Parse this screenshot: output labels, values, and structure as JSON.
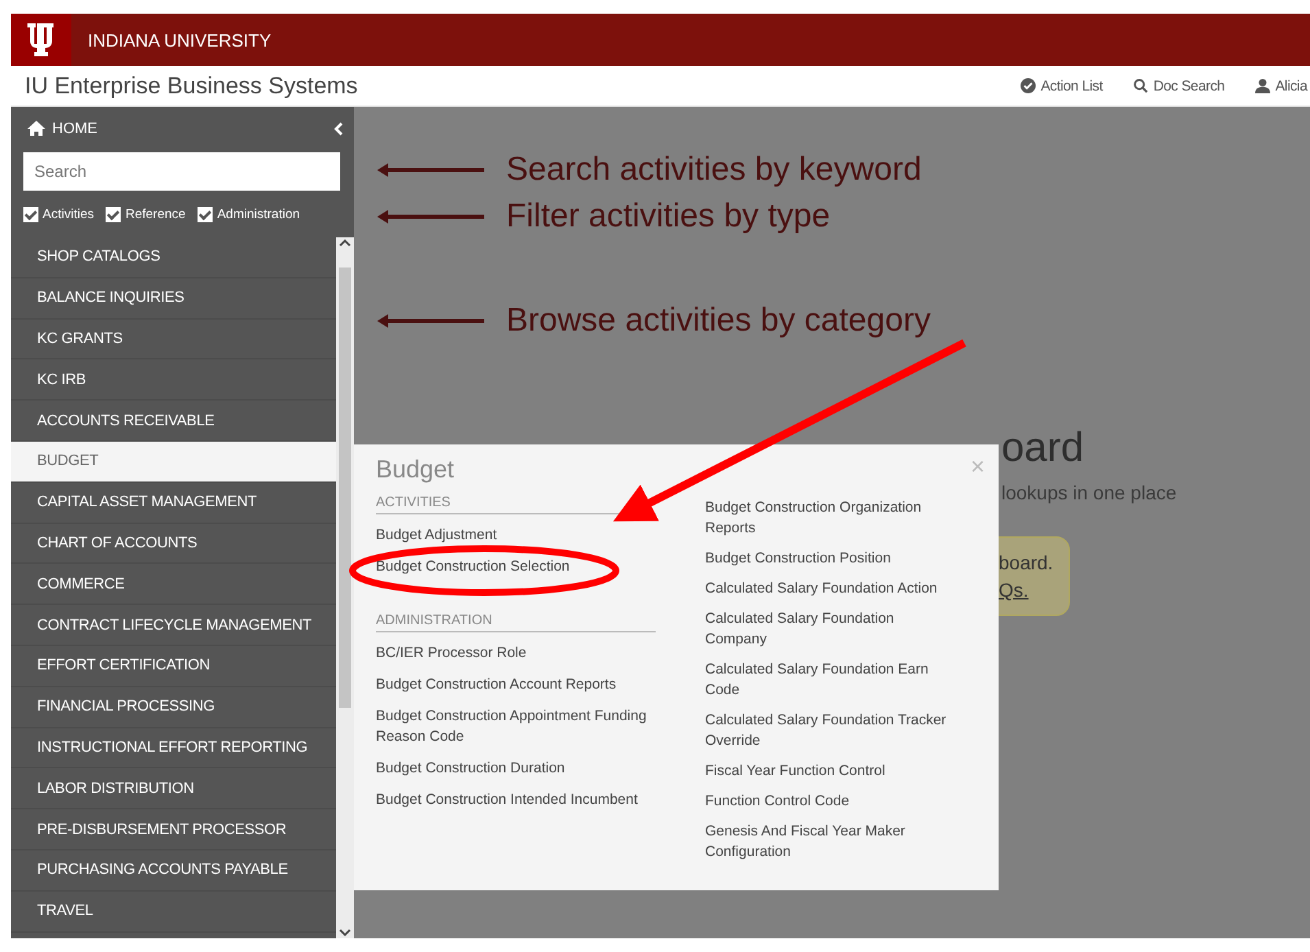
{
  "header": {
    "brand": "INDIANA UNIVERSITY"
  },
  "title_bar": {
    "title": "IU Enterprise Business Systems",
    "links": [
      {
        "kind": "check",
        "label": "Action List"
      },
      {
        "kind": "search",
        "label": "Doc Search"
      },
      {
        "kind": "user",
        "label": "Alicia"
      }
    ]
  },
  "sidebar": {
    "home": "HOME",
    "search": {
      "placeholder": "Search"
    },
    "filters": [
      {
        "label": "Activities",
        "checked": true
      },
      {
        "label": "Reference",
        "checked": true
      },
      {
        "label": "Administration",
        "checked": true
      }
    ],
    "items": [
      {
        "label": "SHOP CATALOGS",
        "selected": false
      },
      {
        "label": "BALANCE INQUIRIES",
        "selected": false
      },
      {
        "label": "KC GRANTS",
        "selected": false
      },
      {
        "label": "KC IRB",
        "selected": false
      },
      {
        "label": "ACCOUNTS RECEIVABLE",
        "selected": false
      },
      {
        "label": "BUDGET",
        "selected": true
      },
      {
        "label": "CAPITAL ASSET MANAGEMENT",
        "selected": false
      },
      {
        "label": "CHART OF ACCOUNTS",
        "selected": false
      },
      {
        "label": "COMMERCE",
        "selected": false
      },
      {
        "label": "CONTRACT LIFECYCLE MANAGEMENT",
        "selected": false
      },
      {
        "label": "EFFORT CERTIFICATION",
        "selected": false
      },
      {
        "label": "FINANCIAL PROCESSING",
        "selected": false
      },
      {
        "label": "INSTRUCTIONAL EFFORT REPORTING",
        "selected": false
      },
      {
        "label": "LABOR DISTRIBUTION",
        "selected": false
      },
      {
        "label": "PRE-DISBURSEMENT PROCESSOR",
        "selected": false
      },
      {
        "label": "PURCHASING ACCOUNTS PAYABLE",
        "selected": false
      },
      {
        "label": "TRAVEL",
        "selected": false
      }
    ]
  },
  "dashboard": {
    "heading": "oard",
    "subtitle": "lookups in one place",
    "notice": {
      "text": "board.",
      "link": "Qs."
    }
  },
  "popup": {
    "title": "Budget",
    "close": "×",
    "sections": [
      {
        "heading": "ACTIVITIES",
        "items": [
          "Budget Adjustment",
          "Budget Construction Selection"
        ]
      },
      {
        "heading": "ADMINISTRATION",
        "items": [
          "BC/IER Processor Role",
          "Budget Construction Account Reports",
          "Budget Construction Appointment Funding Reason Code",
          "Budget Construction Duration",
          "Budget Construction Intended Incumbent"
        ]
      }
    ],
    "column_2": [
      "Budget Construction Organization Reports",
      "Budget Construction Position",
      "Calculated Salary Foundation Action",
      "Calculated Salary Foundation Company",
      "Calculated Salary Foundation Earn Code",
      "Calculated Salary Foundation Tracker Override",
      "Fiscal Year Function Control",
      "Function Control Code",
      "Genesis And Fiscal Year Maker Configuration"
    ]
  },
  "annotations": [
    {
      "text": "Search activities by keyword"
    },
    {
      "text": "Filter activities by type"
    },
    {
      "text": "Browse activities by category"
    }
  ]
}
